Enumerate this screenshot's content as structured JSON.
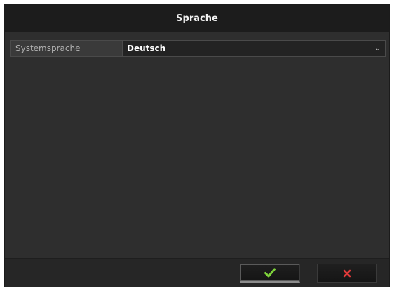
{
  "dialog": {
    "title": "Sprache"
  },
  "setting": {
    "label": "Systemsprache",
    "value": "Deutsch"
  },
  "buttons": {
    "ok_icon": "check-icon",
    "cancel_icon": "close-icon"
  },
  "colors": {
    "ok_icon": "#7ed23a",
    "cancel_icon": "#e03a3a"
  }
}
